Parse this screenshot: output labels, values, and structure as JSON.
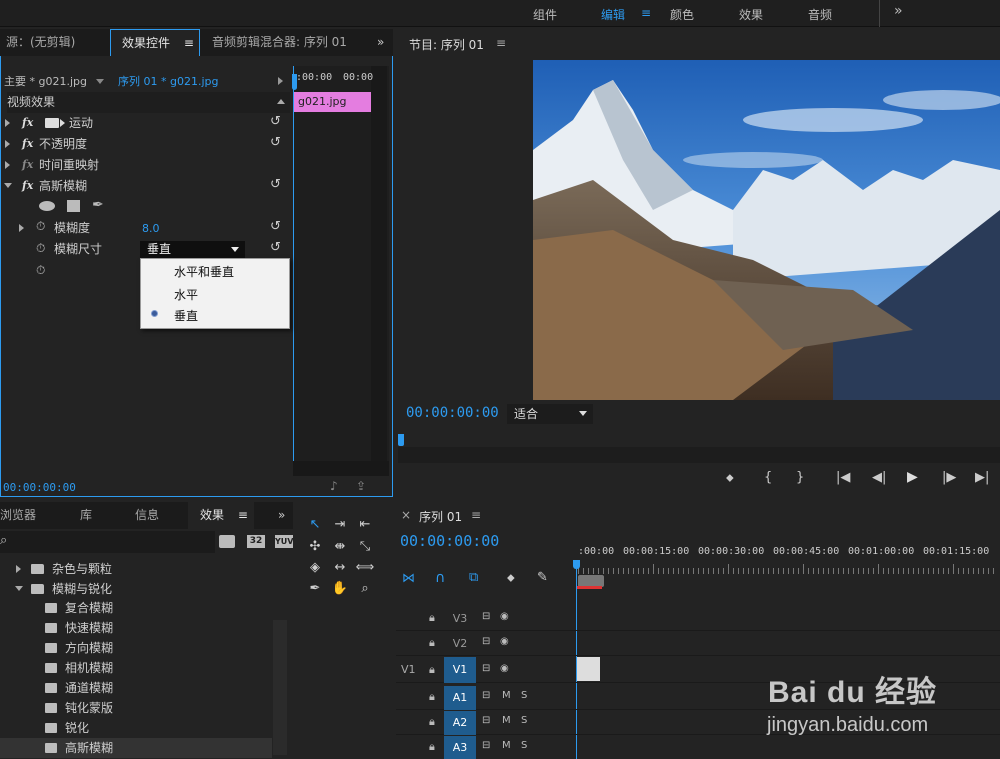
{
  "workspaces": [
    "组件",
    "编辑",
    "颜色",
    "效果",
    "音频"
  ],
  "workspace_menu_icon": "≡",
  "more_icon": "»",
  "effect_controls": {
    "tabs": [
      "源：(无剪辑)",
      "效果控件",
      "音频剪辑混合器: 序列 01"
    ],
    "master_clip": "主要 * g021.jpg",
    "sequence_clip": "序列 01 * g021.jpg",
    "ruler_times": [
      ":00:00",
      "00:00"
    ],
    "clip_name": "g021.jpg",
    "section_title": "视频效果",
    "effects": [
      "运动",
      "不透明度",
      "时间重映射",
      "高斯模糊"
    ],
    "fx_label": "fx",
    "props": {
      "blurriness_label": "模糊度",
      "blurriness_value": "8.0",
      "dimension_label": "模糊尺寸",
      "dimension_value": "垂直"
    },
    "dropdown_options": [
      "水平和垂直",
      "水平",
      "垂直"
    ],
    "dropdown_selected": "垂直",
    "timecode": "00:00:00:00"
  },
  "program": {
    "title": "节目: 序列 01",
    "timecode": "00:00:00:00",
    "zoom": "适合"
  },
  "project": {
    "tabs": [
      "浏览器",
      "库",
      "信息",
      "效果"
    ],
    "search_placeholder": "",
    "badges": [
      "32",
      "YUV"
    ],
    "folders": [
      "杂色与颗粒",
      "模糊与锐化"
    ],
    "items": [
      "复合模糊",
      "快速模糊",
      "方向模糊",
      "相机模糊",
      "通道模糊",
      "钝化蒙版",
      "锐化",
      "高斯模糊"
    ]
  },
  "timeline": {
    "title": "序列 01",
    "timecode": "00:00:00:00",
    "ruler": [
      ":00:00",
      "00:00:15:00",
      "00:00:30:00",
      "00:00:45:00",
      "00:01:00:00",
      "00:01:15:00"
    ],
    "video_tracks": [
      "V3",
      "V2",
      "V1"
    ],
    "audio_tracks": [
      "A1",
      "A2",
      "A3"
    ],
    "source_patch": "V1",
    "mute_label": "M",
    "solo_label": "S"
  },
  "watermark": {
    "logo": "Bai du 经验",
    "url": "jingyan.baidu.com"
  },
  "colors": {
    "accent": "#2d9bf0",
    "clip_pink": "#e47de0",
    "track_blue": "#1f5c8e"
  }
}
